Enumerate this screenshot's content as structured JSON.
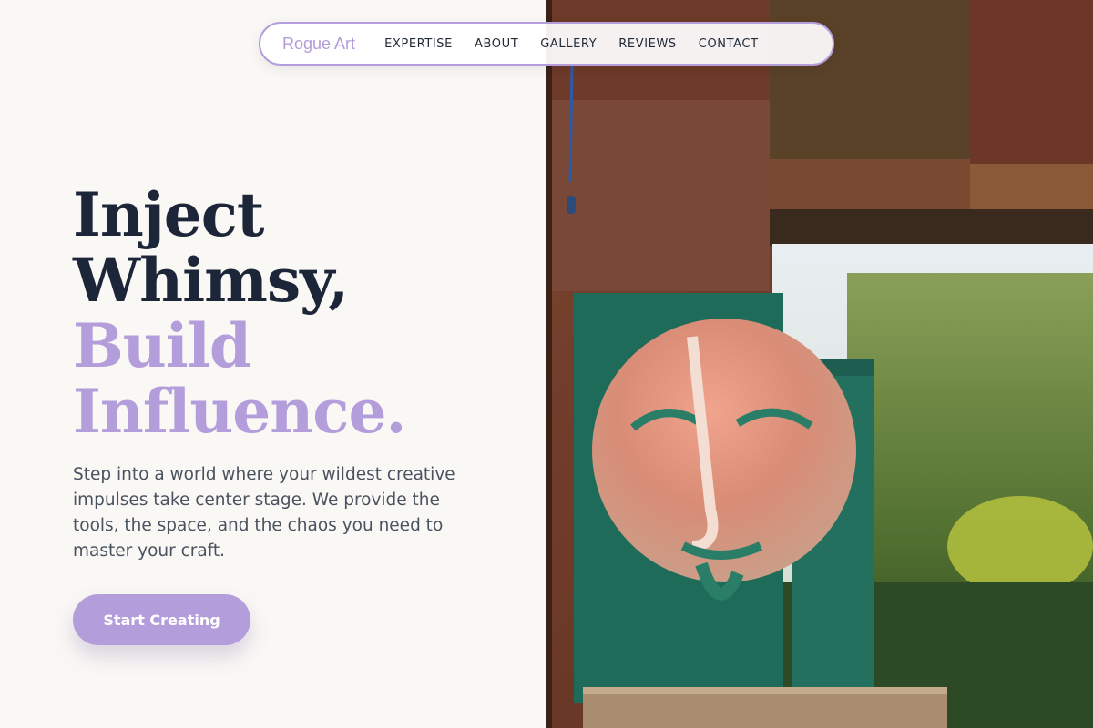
{
  "nav": {
    "brand": "Rogue Art",
    "links": [
      "EXPERTISE",
      "ABOUT",
      "GALLERY",
      "REVIEWS",
      "CONTACT"
    ]
  },
  "hero": {
    "line1": "Inject",
    "line2": "Whimsy,",
    "line3": "Build",
    "line4": "Influence.",
    "lead": "Step into a world where your wildest creative impulses take center stage. We provide the tools, the space, and the chaos you need to master your craft.",
    "cta": "Start Creating"
  },
  "colors": {
    "accent": "#b39ddb",
    "heading": "#1c2638",
    "background": "#faf8f5",
    "body_text": "#4a5260"
  },
  "image": {
    "subject": "painted-face-artwork-photo"
  }
}
